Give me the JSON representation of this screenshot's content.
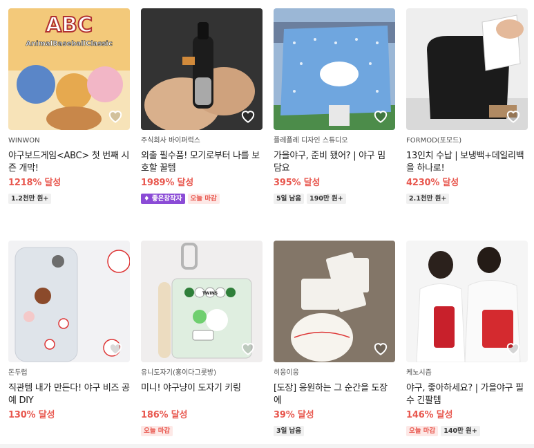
{
  "projects": [
    {
      "creator": "WINWON",
      "title": "야구보드게임<ABC> 첫 번째 시즌 개막!",
      "achievement": "1218% 달성",
      "badges": [
        {
          "text": "1.2천만 원+",
          "style": "gray"
        }
      ],
      "art_text": [
        "ABC",
        "AnimalBaseballClassic"
      ]
    },
    {
      "creator": "주식회사 바이퍼럭스",
      "title": "외출 필수품! 모기로부터 나를 보호할 꿀템",
      "achievement": "1989% 달성",
      "badges": [
        {
          "text": "♦ 좋은창작자",
          "style": "purple"
        },
        {
          "text": "오늘 마감",
          "style": "red"
        }
      ]
    },
    {
      "creator": "플레플레 디자인 스튜디오",
      "title": "가을야구, 준비 됐어? | 야구 밈 담요",
      "achievement": "395% 달성",
      "badges": [
        {
          "text": "5일 남음",
          "style": "gray"
        },
        {
          "text": "190만 원+",
          "style": "gray"
        }
      ]
    },
    {
      "creator": "FORMOD(포모드)",
      "title": "13인치 수납 | 보냉백+데일리백을 하나로!",
      "achievement": "4230% 달성",
      "badges": [
        {
          "text": "2.1천만 원+",
          "style": "gray"
        }
      ]
    },
    {
      "creator": "돈두럽",
      "title": "직관템 내가 만든다! 야구 비즈 공예 DIY",
      "achievement": "130% 달성",
      "badges": []
    },
    {
      "creator": "유니도자기(홍이다그릇방)",
      "title": "미니! 야구냥이 도자기 키링",
      "achievement": "186% 달성",
      "badges": [
        {
          "text": "오늘 마감",
          "style": "red"
        }
      ],
      "art_text": [
        "TWINS"
      ]
    },
    {
      "creator": "히웅이웅",
      "title": "[도장] 응원하는 그 순간을 도장에",
      "achievement": "39% 달성",
      "badges": [
        {
          "text": "3일 남음",
          "style": "gray"
        }
      ]
    },
    {
      "creator": "케노시즘",
      "title": "야구, 좋아하세요? | 가을야구 필수 긴팔템",
      "achievement": "146% 달성",
      "badges": [
        {
          "text": "오늘 마감",
          "style": "red"
        },
        {
          "text": "140만 원+",
          "style": "gray"
        }
      ]
    }
  ],
  "icons": {
    "like": "heart-outline-icon"
  },
  "colors": {
    "accent": "#e8584f",
    "badge_gray": "#f0f0f0",
    "badge_red_bg": "#fde8e6",
    "badge_purple": "#8b4bd6"
  }
}
